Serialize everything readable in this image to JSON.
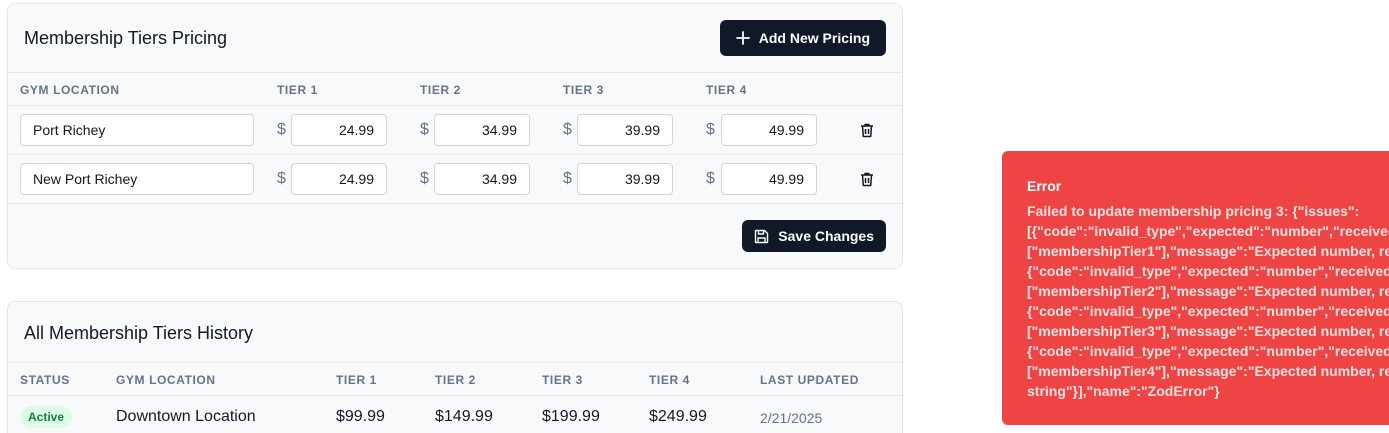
{
  "pricing": {
    "title": "Membership Tiers Pricing",
    "add_button_label": "Add New Pricing",
    "save_button_label": "Save Changes",
    "columns": [
      "GYM LOCATION",
      "TIER 1",
      "TIER 2",
      "TIER 3",
      "TIER 4"
    ],
    "currency": "$",
    "rows": [
      {
        "location": "Port Richey",
        "tiers": [
          "24.99",
          "34.99",
          "39.99",
          "49.99"
        ]
      },
      {
        "location": "New Port Richey",
        "tiers": [
          "24.99",
          "34.99",
          "39.99",
          "49.99"
        ]
      }
    ]
  },
  "history": {
    "title": "All Membership Tiers History",
    "columns": [
      "STATUS",
      "GYM LOCATION",
      "TIER 1",
      "TIER 2",
      "TIER 3",
      "TIER 4",
      "LAST UPDATED"
    ],
    "rows": [
      {
        "status": "Active",
        "location": "Downtown Location",
        "tier1": "$99.99",
        "tier2": "$149.99",
        "tier3": "$199.99",
        "tier4": "$249.99",
        "last_updated": "2/21/2025"
      }
    ]
  },
  "toast": {
    "title": "Error",
    "message": "Failed to update membership pricing 3: {\"issues\":\n[{\"code\":\"invalid_type\",\"expected\":\"number\",\"received\n[\"membershipTier1\"],\"message\":\"Expected number, rec\n{\"code\":\"invalid_type\",\"expected\":\"number\",\"received\n[\"membershipTier2\"],\"message\":\"Expected number, re\n{\"code\":\"invalid_type\",\"expected\":\"number\",\"received\n[\"membershipTier3\"],\"message\":\"Expected number, re\n{\"code\":\"invalid_type\",\"expected\":\"number\",\"received\n[\"membershipTier4\"],\"message\":\"Expected number, re\nstring\"}],\"name\":\"ZodError\"}"
  }
}
